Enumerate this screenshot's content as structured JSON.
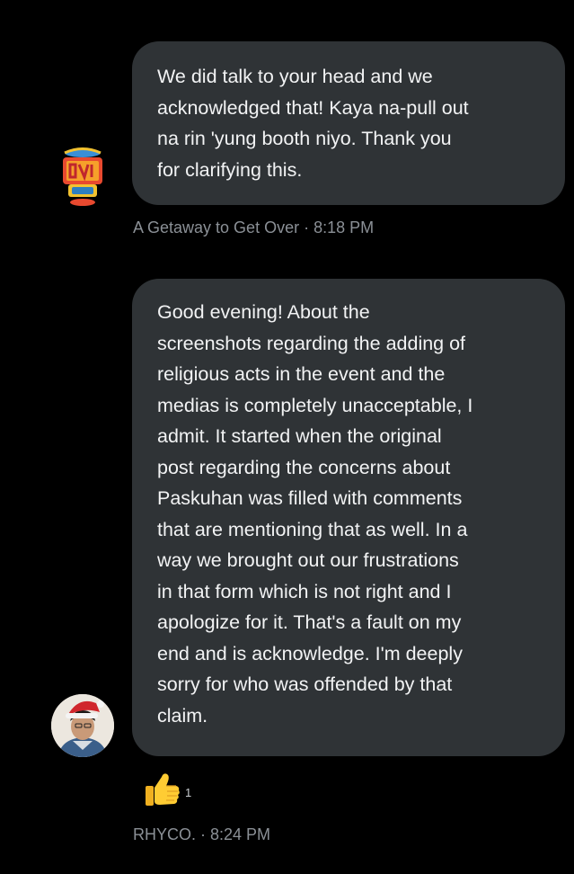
{
  "messages": [
    {
      "lines": [
        "We did talk to your head and we",
        "acknowledged that! Kaya na-pull out",
        "na rin 'yung booth niyo. Thank you",
        "for clarifying this."
      ],
      "sender": "A Getaway to Get Over",
      "time": "8:18 PM",
      "meta": "A Getaway to Get Over · 8:18 PM",
      "avatar_icon": "event-logo-icon"
    },
    {
      "lines": [
        "Good evening! About the",
        "screenshots regarding the adding of",
        "religious acts in the event and the",
        "medias is completely unacceptable, I",
        "admit. It started when the original",
        "post regarding the concerns about",
        "Paskuhan was filled with comments",
        "that are mentioning that as well. In a",
        "way we brought out our frustrations",
        "in that form which is not right and I",
        "apologize for it. That's a fault on my",
        "end and is acknowledge. I'm deeply",
        "sorry for who was offended by that",
        "claim."
      ],
      "sender": "RHYCO.",
      "time": "8:24 PM",
      "meta": "RHYCO. · 8:24 PM",
      "avatar_icon": "santa-hat-avatar-icon",
      "reaction": {
        "icon": "thumbs-up-icon",
        "count": "1"
      }
    }
  ],
  "colors": {
    "background": "#000000",
    "bubble": "#2f3336",
    "meta_text": "#8b9096"
  }
}
